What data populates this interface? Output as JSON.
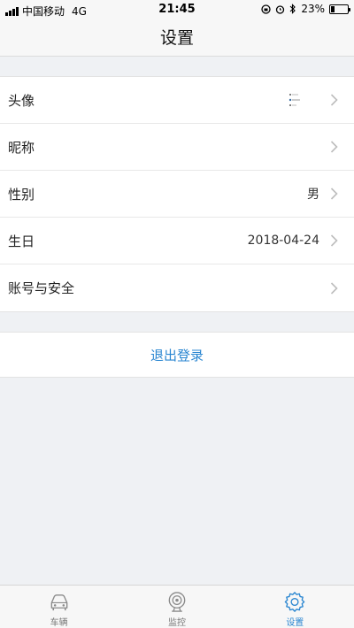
{
  "status_bar": {
    "carrier": "中国移动",
    "network": "4G",
    "time": "21:45",
    "battery": "23%",
    "battery_level": 0.23
  },
  "nav": {
    "title": "设置"
  },
  "settings": {
    "avatar_label": "头像",
    "nickname_label": "昵称",
    "gender_label": "性别",
    "gender_value": "男",
    "birthday_label": "生日",
    "birthday_value": "2018-04-24",
    "account_label": "账号与安全"
  },
  "logout_label": "退出登录",
  "tabs": [
    {
      "label": "车辆",
      "icon": "car-icon"
    },
    {
      "label": "监控",
      "icon": "camera-icon"
    },
    {
      "label": "设置",
      "icon": "gear-icon"
    }
  ],
  "colors": {
    "accent": "#2a86d1",
    "background": "#eff1f4"
  }
}
